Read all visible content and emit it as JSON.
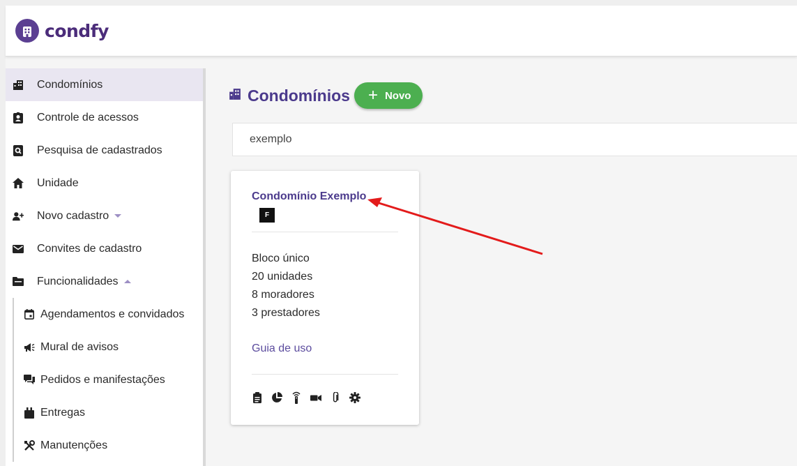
{
  "brand": {
    "name": "condfy"
  },
  "sidebar": {
    "items": [
      {
        "label": "Condomínios",
        "icon": "buildings-icon",
        "active": true
      },
      {
        "label": "Controle de acessos",
        "icon": "badge-icon"
      },
      {
        "label": "Pesquisa de cadastrados",
        "icon": "search-doc-icon"
      },
      {
        "label": "Unidade",
        "icon": "home-icon"
      },
      {
        "label": "Novo cadastro",
        "icon": "add-user-icon"
      },
      {
        "label": "Convites de cadastro",
        "icon": "mail-icon"
      },
      {
        "label": "Funcionalidades",
        "icon": "folder-icon"
      }
    ],
    "subitems": [
      {
        "label": "Agendamentos e convidados",
        "icon": "calendar-icon"
      },
      {
        "label": "Mural de avisos",
        "icon": "megaphone-icon"
      },
      {
        "label": "Pedidos e manifestações",
        "icon": "chat-icon"
      },
      {
        "label": "Entregas",
        "icon": "package-icon"
      },
      {
        "label": "Manutenções",
        "icon": "tools-icon"
      }
    ]
  },
  "main": {
    "title": "Condomínios",
    "new_button": "Novo",
    "search_value": "exemplo"
  },
  "card": {
    "title": "Condomínio Exemplo",
    "badge": "F",
    "lines": [
      "Bloco único",
      "20 unidades",
      "8 moradores",
      "3 prestadores"
    ],
    "guide_link": "Guia de uso",
    "actions": [
      "clipboard-icon",
      "pie-chart-icon",
      "remote-control-icon",
      "video-camera-icon",
      "paperclip-icon",
      "gear-icon"
    ]
  },
  "colors": {
    "accent": "#4b3a8c",
    "brand": "#5b3f92",
    "new_button": "#4caf50",
    "annotation_arrow": "#e31b1b"
  }
}
